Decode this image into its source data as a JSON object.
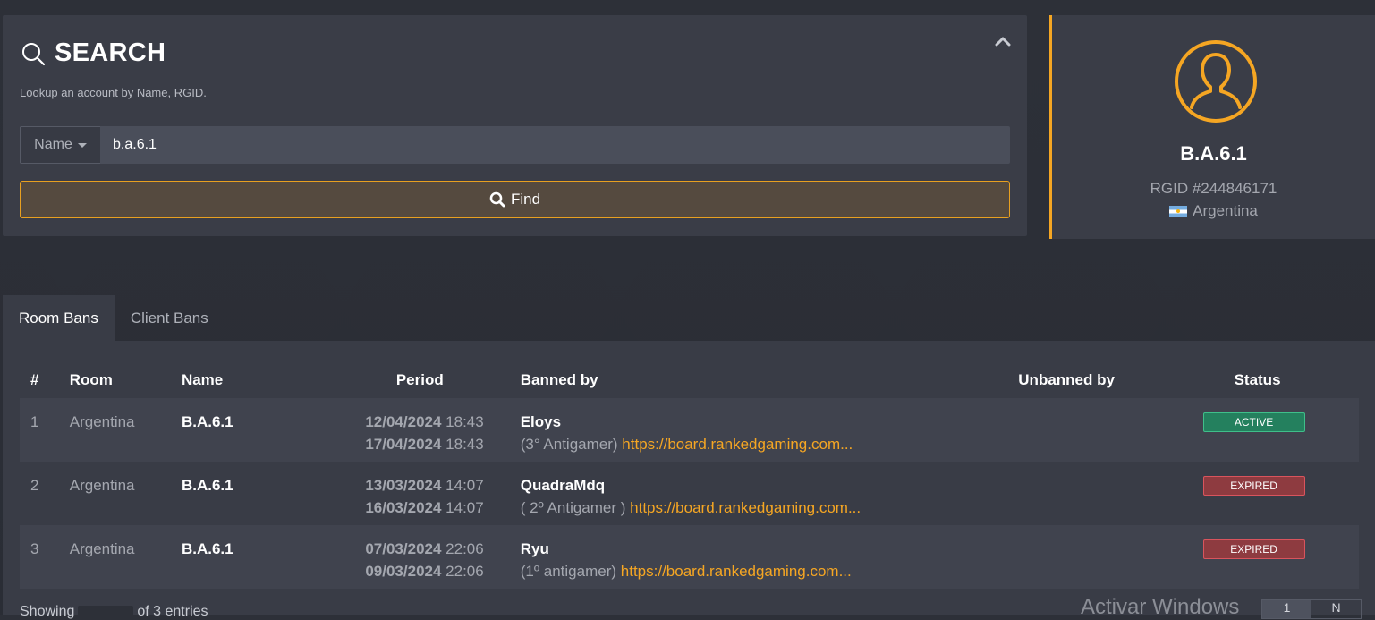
{
  "search": {
    "title": "SEARCH",
    "subtitle": "Lookup an account by Name, RGID.",
    "filter_selected": "Name",
    "query_value": "b.a.6.1",
    "find_label": "Find",
    "icon": "search-icon",
    "collapse_icon": "chevron-up-icon"
  },
  "profile": {
    "avatar_icon": "user-avatar-icon",
    "name": "B.A.6.1",
    "rgid": "RGID #244846171",
    "country": "Argentina",
    "flag_icon": "argentina-flag-icon",
    "accent_color": "#f5a623"
  },
  "tabs": [
    {
      "label": "Room Bans",
      "active": true
    },
    {
      "label": "Client Bans",
      "active": false
    }
  ],
  "table": {
    "headers": {
      "num": "#",
      "room": "Room",
      "name": "Name",
      "period": "Period",
      "banned_by": "Banned by",
      "unbanned_by": "Unbanned by",
      "status": "Status"
    },
    "rows": [
      {
        "num": "1",
        "room": "Argentina",
        "name": "B.A.6.1",
        "start_date": "12/04/2024",
        "start_time": "18:43",
        "end_date": "17/04/2024",
        "end_time": "18:43",
        "banned_by": "Eloys",
        "reason": "(3° Antigamer)",
        "link": "https://board.rankedgaming.com...",
        "unbanned_by": "",
        "status": "ACTIVE"
      },
      {
        "num": "2",
        "room": "Argentina",
        "name": "B.A.6.1",
        "start_date": "13/03/2024",
        "start_time": "14:07",
        "end_date": "16/03/2024",
        "end_time": "14:07",
        "banned_by": "QuadraMdq",
        "reason": "( 2º Antigamer )",
        "link": "https://board.rankedgaming.com...",
        "unbanned_by": "",
        "status": "EXPIRED"
      },
      {
        "num": "3",
        "room": "Argentina",
        "name": "B.A.6.1",
        "start_date": "07/03/2024",
        "start_time": "22:06",
        "end_date": "09/03/2024",
        "end_time": "22:06",
        "banned_by": "Ryu",
        "reason": "(1º antigamer)",
        "link": "https://board.rankedgaming.com...",
        "unbanned_by": "",
        "status": "EXPIRED"
      }
    ],
    "status_colors": {
      "ACTIVE": "#24805e",
      "EXPIRED": "#8e3b40"
    }
  },
  "footer": {
    "showing_prefix": "Showing",
    "showing_suffix": "of 3 entries",
    "watermark": "Activar Windows",
    "pager": [
      "1",
      "N"
    ]
  }
}
